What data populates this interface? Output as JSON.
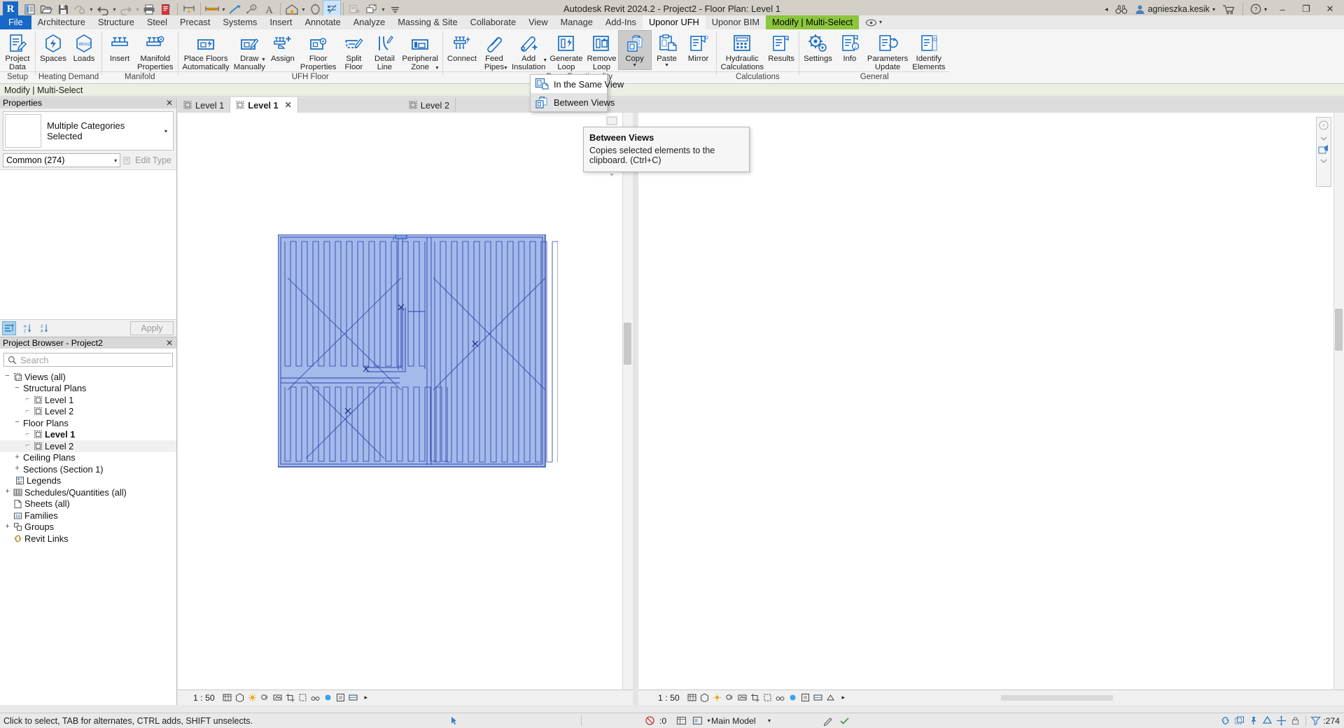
{
  "window": {
    "title": "Autodesk Revit 2024.2 - Project2 - Floor Plan: Level 1",
    "user": "agnieszka.kesik",
    "minimize_label": "–",
    "restore_label": "❐",
    "close_label": "✕",
    "search_arrow": "◂",
    "help_caret": "▾",
    "user_caret": "▾"
  },
  "quick_access": {
    "logo": "R",
    "items": [
      {
        "name": "open-project-list-icon",
        "label": "Project List"
      },
      {
        "name": "open-icon",
        "label": "Open"
      },
      {
        "name": "save-icon",
        "label": "Save"
      },
      {
        "name": "sync-with-central-icon",
        "label": "Synchronize with Central",
        "caret": true
      },
      {
        "name": "undo-icon",
        "label": "Undo",
        "caret": true
      },
      {
        "name": "redo-icon",
        "label": "Redo",
        "caret": true
      },
      {
        "name": "print-icon",
        "label": "Print"
      },
      {
        "name": "measure-sheet-icon",
        "label": "Measure"
      },
      {
        "name": "align-dimension-icon",
        "label": "Aligned Dimension"
      },
      {
        "name": "tag-icon",
        "label": "Tag by Category",
        "caret": true
      },
      {
        "name": "detail-line-icon",
        "label": "Detail Line"
      },
      {
        "name": "tag-number-icon",
        "label": "Tag"
      },
      {
        "name": "text-icon",
        "label": "Text"
      },
      {
        "name": "default-3d-view-icon",
        "label": "Default 3D View",
        "caret": true
      },
      {
        "name": "section-icon",
        "label": "Section"
      },
      {
        "name": "thin-lines-icon",
        "label": "Thin Lines"
      },
      {
        "name": "close-hidden-windows-icon",
        "label": "Close Inactive Views"
      },
      {
        "name": "switch-windows-icon",
        "label": "Switch Windows",
        "caret": true
      },
      {
        "name": "customize-qat-icon",
        "label": "Customize Quick Access Toolbar"
      }
    ]
  },
  "tabs": [
    {
      "label": "File",
      "state": "file"
    },
    {
      "label": "Architecture",
      "state": "normal"
    },
    {
      "label": "Structure",
      "state": "normal"
    },
    {
      "label": "Steel",
      "state": "normal"
    },
    {
      "label": "Precast",
      "state": "normal"
    },
    {
      "label": "Systems",
      "state": "normal"
    },
    {
      "label": "Insert",
      "state": "normal"
    },
    {
      "label": "Annotate",
      "state": "normal"
    },
    {
      "label": "Analyze",
      "state": "normal"
    },
    {
      "label": "Massing & Site",
      "state": "normal"
    },
    {
      "label": "Collaborate",
      "state": "normal"
    },
    {
      "label": "View",
      "state": "normal"
    },
    {
      "label": "Manage",
      "state": "normal"
    },
    {
      "label": "Add-Ins",
      "state": "normal"
    },
    {
      "label": "Uponor UFH",
      "state": "active"
    },
    {
      "label": "Uponor BIM",
      "state": "normal"
    },
    {
      "label": "Modify | Multi-Select",
      "state": "contextual"
    }
  ],
  "display_options": {
    "icon": "display-options-icon",
    "caret": "▾"
  },
  "ribbon": {
    "panels": [
      {
        "title": "Setup",
        "buttons": [
          {
            "name": "project-data-button",
            "label": "Project\nData",
            "icon": "project-data-icon",
            "state": "normal"
          }
        ]
      },
      {
        "title": "Heating Demand",
        "buttons": [
          {
            "name": "spaces-button",
            "label": "Spaces",
            "icon": "spaces-icon",
            "state": "normal"
          },
          {
            "name": "loads-button",
            "label": "Loads",
            "icon": "loads-icon",
            "state": "normal"
          }
        ]
      },
      {
        "title": "Manifold",
        "buttons": [
          {
            "name": "insert-button",
            "label": "Insert",
            "icon": "manifold-insert-icon",
            "state": "normal"
          },
          {
            "name": "manifold-properties-button",
            "label": "Manifold\nProperties",
            "icon": "manifold-properties-icon",
            "state": "normal"
          }
        ]
      },
      {
        "title": "UFH Floor",
        "buttons": [
          {
            "name": "place-floors-automatically-button",
            "label": "Place Floors\nAutomatically",
            "icon": "place-floors-icon",
            "state": "normal"
          },
          {
            "name": "draw-manually-button",
            "label": "Draw\nManually",
            "icon": "draw-manually-icon",
            "state": "normal",
            "caret": true
          },
          {
            "name": "assign-button",
            "label": "Assign",
            "icon": "assign-icon",
            "state": "normal"
          },
          {
            "name": "floor-properties-button",
            "label": "Floor\nProperties",
            "icon": "floor-properties-icon",
            "state": "normal"
          },
          {
            "name": "split-floor-button",
            "label": "Split\nFloor",
            "icon": "split-floor-icon",
            "state": "normal"
          },
          {
            "name": "detail-line-button",
            "label": "Detail\nLine",
            "icon": "detail-line-icon",
            "state": "normal"
          },
          {
            "name": "peripheral-zone-button",
            "label": "Peripheral\nZone",
            "icon": "peripheral-zone-icon",
            "state": "normal",
            "caret": true
          }
        ]
      },
      {
        "title": "Draw Functionality",
        "buttons": [
          {
            "name": "connect-button",
            "label": "Connect",
            "icon": "connect-icon",
            "state": "normal"
          },
          {
            "name": "feed-pipes-button",
            "label": "Feed\nPipes",
            "icon": "feed-pipes-icon",
            "state": "normal",
            "caret": true
          },
          {
            "name": "add-insulation-button",
            "label": "Add\nInsulation",
            "icon": "add-insulation-icon",
            "state": "normal",
            "caret": true
          },
          {
            "name": "generate-loop-button",
            "label": "Generate\nLoop",
            "icon": "generate-loop-icon",
            "state": "normal"
          },
          {
            "name": "remove-loop-button",
            "label": "Remove\nLoop",
            "icon": "remove-loop-icon",
            "state": "normal"
          },
          {
            "name": "copy-button",
            "label": "Copy",
            "icon": "copy-icon",
            "state": "pressed",
            "caret": true
          },
          {
            "name": "paste-button",
            "label": "Paste",
            "icon": "paste-icon",
            "state": "normal",
            "caret": true
          },
          {
            "name": "mirror-button",
            "label": "Mirror",
            "icon": "mirror-icon",
            "state": "normal"
          }
        ]
      },
      {
        "title": "Calculations",
        "buttons": [
          {
            "name": "hydraulic-calculations-button",
            "label": "Hydraulic\nCalculations",
            "icon": "hydraulic-calculations-icon",
            "state": "normal"
          },
          {
            "name": "results-button",
            "label": "Results",
            "icon": "results-icon",
            "state": "normal"
          }
        ]
      },
      {
        "title": "General",
        "buttons": [
          {
            "name": "settings-button",
            "label": "Settings",
            "icon": "settings-icon",
            "state": "normal"
          },
          {
            "name": "info-button",
            "label": "Info",
            "icon": "info-icon",
            "state": "normal"
          },
          {
            "name": "parameters-update-button",
            "label": "Parameters\nUpdate",
            "icon": "parameters-update-icon",
            "state": "normal"
          },
          {
            "name": "identify-elements-button",
            "label": "Identify\nElements",
            "icon": "identify-elements-icon",
            "state": "normal"
          }
        ]
      }
    ]
  },
  "options_bar": {
    "text": "Modify | Multi-Select"
  },
  "copy_menu": {
    "items": [
      {
        "label": "In the Same View",
        "icon": "copy-same-view-icon",
        "highlighted": false
      },
      {
        "label": "Between Views",
        "icon": "copy-between-views-icon",
        "highlighted": true
      }
    ]
  },
  "tooltip": {
    "title": "Between Views",
    "body": "Copies selected elements to the clipboard. (Ctrl+C)"
  },
  "properties": {
    "header": "Properties",
    "close": "✕",
    "type_name": "Multiple Categories Selected",
    "type_caret": "▾",
    "selector_value": "Common (274)",
    "selector_caret": "▾",
    "edit_type": "Edit Type",
    "apply_label": "Apply",
    "sort_buttons": [
      {
        "name": "group-properties-icon",
        "active": true
      },
      {
        "name": "sort-ascending-icon",
        "active": false
      },
      {
        "name": "sort-descending-icon",
        "active": false
      }
    ]
  },
  "project_browser": {
    "header": "Project Browser - Project2",
    "close": "✕",
    "search_placeholder": "Search",
    "tree": [
      {
        "label": "Views (all)",
        "indent": 0,
        "expander": "−",
        "icon": "views-icon",
        "bold": false,
        "selected": false
      },
      {
        "label": "Structural Plans",
        "indent": 1,
        "expander": "−",
        "icon": "",
        "bold": false,
        "selected": false
      },
      {
        "label": "Level 1",
        "indent": 2,
        "expander": "",
        "icon": "plan-view-icon",
        "bold": false,
        "selected": false
      },
      {
        "label": "Level 2",
        "indent": 2,
        "expander": "",
        "icon": "plan-view-icon",
        "bold": false,
        "selected": false
      },
      {
        "label": "Floor Plans",
        "indent": 1,
        "expander": "−",
        "icon": "",
        "bold": false,
        "selected": false
      },
      {
        "label": "Level 1",
        "indent": 2,
        "expander": "",
        "icon": "plan-view-icon",
        "bold": true,
        "selected": false
      },
      {
        "label": "Level 2",
        "indent": 2,
        "expander": "",
        "icon": "plan-view-icon",
        "bold": false,
        "selected": true
      },
      {
        "label": "Ceiling Plans",
        "indent": 1,
        "expander": "+",
        "icon": "",
        "bold": false,
        "selected": false
      },
      {
        "label": "Sections (Section 1)",
        "indent": 1,
        "expander": "+",
        "icon": "",
        "bold": false,
        "selected": false
      },
      {
        "label": "Legends",
        "indent": 1,
        "expander": "",
        "icon": "legend-icon",
        "bold": false,
        "selected": false
      },
      {
        "label": "Schedules/Quantities (all)",
        "indent": 0,
        "expander": "+",
        "icon": "schedule-icon",
        "bold": false,
        "selected": false
      },
      {
        "label": "Sheets (all)",
        "indent": 0,
        "expander": "",
        "icon": "sheet-icon",
        "bold": false,
        "selected": false
      },
      {
        "label": "Families",
        "indent": 0,
        "expander": "",
        "icon": "families-icon",
        "bold": false,
        "selected": false
      },
      {
        "label": "Groups",
        "indent": 0,
        "expander": "+",
        "icon": "groups-icon",
        "bold": false,
        "selected": false
      },
      {
        "label": "Revit Links",
        "indent": 0,
        "expander": "",
        "icon": "revit-links-icon",
        "bold": false,
        "selected": false
      }
    ]
  },
  "view_tabs": [
    {
      "label": "Level 1",
      "active": false,
      "closable": false,
      "icon": "view-tab-icon"
    },
    {
      "label": "Level 1",
      "active": true,
      "closable": true,
      "icon": "view-tab-icon"
    },
    {
      "label": "Level 2",
      "active": false,
      "closable": false,
      "icon": "view-tab-icon"
    }
  ],
  "view_controls": {
    "left_scale": "1 : 50",
    "right_scale": "1 : 50",
    "more_caret": "▸"
  },
  "status_bar": {
    "message": "Click to select, TAB for alternates, CTRL adds, SHIFT unselects.",
    "worksets_label": "",
    "design_option": "Main Model",
    "filter_count": ":274",
    "excluded_count": ":0",
    "caret": "▾"
  }
}
